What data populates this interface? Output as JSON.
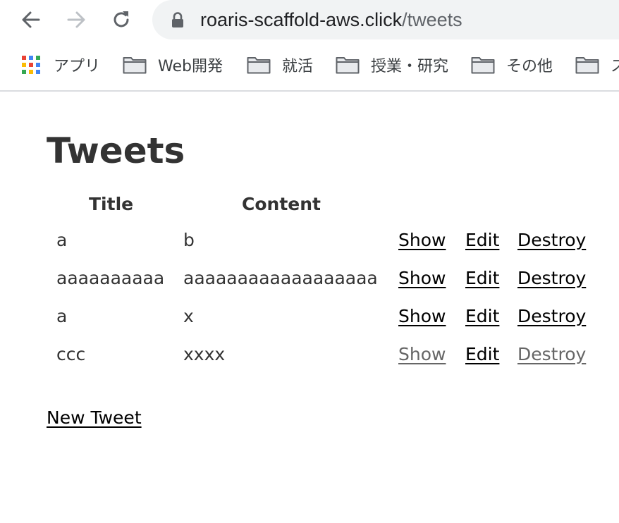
{
  "browser": {
    "icons": {
      "back": "arrow-left-icon",
      "forward": "arrow-right-icon",
      "reload": "reload-icon",
      "lock": "lock-icon"
    },
    "url": {
      "host": "roaris-scaffold-aws.click",
      "path": "/tweets"
    },
    "bookmarks": {
      "apps_label": "アプリ",
      "folders": [
        "Web開発",
        "就活",
        "授業・研究",
        "その他",
        "ス"
      ]
    }
  },
  "page": {
    "title": "Tweets",
    "table": {
      "headers": [
        "Title",
        "Content"
      ],
      "rows": [
        {
          "title": "a",
          "content": "b",
          "show": "Show",
          "edit": "Edit",
          "destroy": "Destroy"
        },
        {
          "title": "aaaaaaaaaa",
          "content": "aaaaaaaaaaaaaaaaaa",
          "show": "Show",
          "edit": "Edit",
          "destroy": "Destroy"
        },
        {
          "title": "a",
          "content": "x",
          "show": "Show",
          "edit": "Edit",
          "destroy": "Destroy"
        },
        {
          "title": "ccc",
          "content": "xxxx",
          "show": "Show",
          "edit": "Edit",
          "destroy": "Destroy"
        }
      ]
    },
    "new_link": "New Tweet",
    "colors": {
      "text": "#333333",
      "link": "#000000",
      "visited_link": "#666666"
    }
  }
}
